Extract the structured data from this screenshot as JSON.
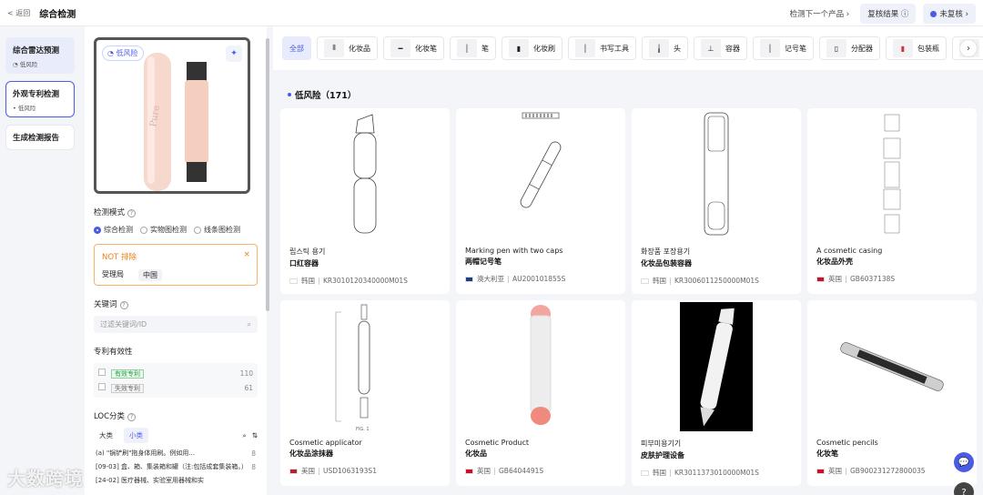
{
  "topbar": {
    "back": "< 返回",
    "title": "综合检测",
    "next": "检测下一个产品 ›",
    "review_result": "复核结果 ⓘ",
    "status": "未复核 ›"
  },
  "leftnav": {
    "items": [
      {
        "title": "综合雷达预测",
        "sub": "低风险"
      },
      {
        "title": "外观专利检测",
        "sub": "• 低风险"
      },
      {
        "title": "生成检测报告"
      }
    ]
  },
  "panel": {
    "risk_tag": "低风险",
    "mode_label": "检测模式",
    "modes": [
      "综合检测",
      "实物图检测",
      "线条图检测"
    ],
    "not_label": "NOT",
    "not_action": "排除",
    "not_field": "受理局",
    "not_value": "中国",
    "keyword_label": "关键词",
    "keyword_placeholder": "过滤关键词/ID",
    "validity_label": "专利有效性",
    "validity": [
      {
        "label": "有效专利",
        "count": "110"
      },
      {
        "label": "失效专利",
        "count": "61"
      }
    ],
    "loc_label": "LOC分类",
    "loc_tabs": [
      "大类",
      "小类"
    ],
    "loc_items": [
      {
        "text": "(a) \"锅铲刷\"拖身体用刷。例如用...",
        "count": "8"
      },
      {
        "text": "[09-03] 盒、箱、集装箱和罐（注:包括成套集装箱。）",
        "count": "8"
      },
      {
        "text": "[24-02] 医疗器械、实验室用器械和实",
        "count": ""
      }
    ]
  },
  "categories": [
    "全部",
    "化妆品",
    "化妆笔",
    "笔",
    "化妆刷",
    "书写工具",
    "头",
    "容器",
    "记号笔",
    "分配器",
    "包装瓶",
    "其"
  ],
  "results": {
    "heading": "低风险（171）",
    "cards": [
      {
        "t1": "립스틱 용기",
        "t2": "口红容器",
        "country": "韩国",
        "id": "KR3010120340000M01S",
        "flag": "kr"
      },
      {
        "t1": "Marking pen with two caps",
        "t2": "两帽记号笔",
        "country": "澳大利亚",
        "id": "AU200101855S",
        "flag": "au"
      },
      {
        "t1": "화장품 포장용기",
        "t2": "化妆品包装容器",
        "country": "韩国",
        "id": "KR3006011250000M01S",
        "flag": "kr"
      },
      {
        "t1": "A cosmetic casing",
        "t2": "化妆品外壳",
        "country": "英国",
        "id": "GB6037138S",
        "flag": "gb"
      },
      {
        "t1": "Cosmetic applicator",
        "t2": "化妆品涂抹器",
        "country": "美国",
        "id": "USD1063193S1",
        "flag": "us"
      },
      {
        "t1": "Cosmetic Product",
        "t2": "化妆品",
        "country": "英国",
        "id": "GB6404491S",
        "flag": "gb"
      },
      {
        "t1": "피부미용기기",
        "t2": "皮肤护理设备",
        "country": "韩国",
        "id": "KR3011373010000M01S",
        "flag": "kr"
      },
      {
        "t1": "Cosmetic pencils",
        "t2": "化妆笔",
        "country": "英国",
        "id": "GB900231272800035",
        "flag": "gb"
      }
    ]
  },
  "colors": {
    "accent": "#4a5be6",
    "warn": "#e8831c"
  },
  "watermark": "大数跨境"
}
